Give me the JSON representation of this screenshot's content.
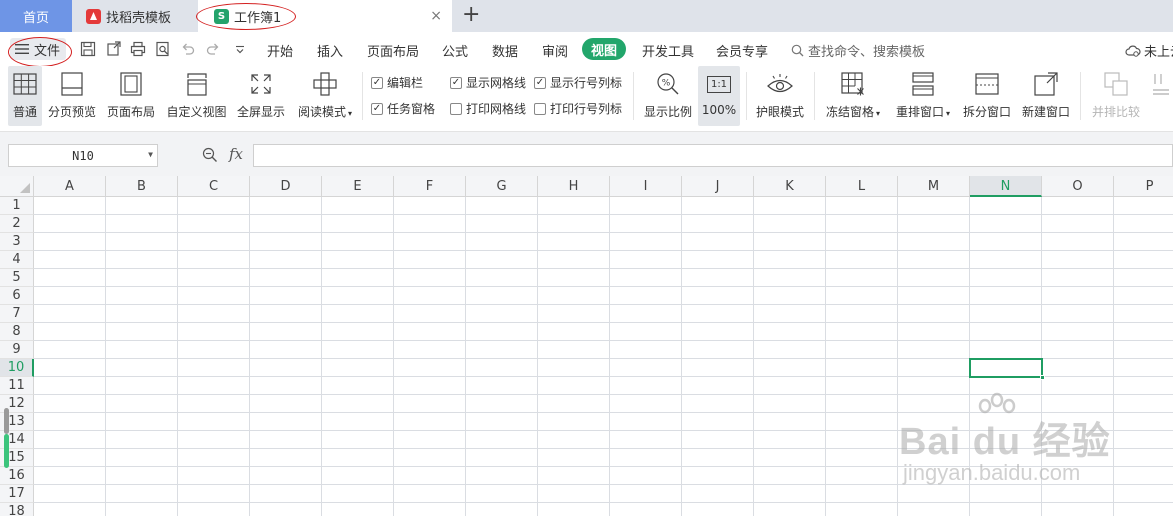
{
  "tabs": {
    "home": "首页",
    "template": "找稻壳模板",
    "workbook": "工作簿1",
    "workbook_logo": "S",
    "add": "+",
    "close": "×"
  },
  "menu": {
    "file": "文件",
    "items": [
      "开始",
      "插入",
      "页面布局",
      "公式",
      "数据",
      "审阅",
      "视图",
      "开发工具",
      "会员专享"
    ],
    "active": "视图",
    "search": "查找命令、搜索模板",
    "cloud": "未上云"
  },
  "ribbon": {
    "normal": "普通",
    "page_break_preview": "分页预览",
    "page_layout": "页面布局",
    "custom_view": "自定义视图",
    "full_screen": "全屏显示",
    "reading_mode": "阅读模式",
    "checks": {
      "edit_bar": {
        "label": "编辑栏",
        "checked": true
      },
      "task_pane": {
        "label": "任务窗格",
        "checked": true
      },
      "show_gridlines": {
        "label": "显示网格线",
        "checked": true
      },
      "print_gridlines": {
        "label": "打印网格线",
        "checked": false
      },
      "show_headings": {
        "label": "显示行号列标",
        "checked": true
      },
      "print_headings": {
        "label": "打印行号列标",
        "checked": false
      }
    },
    "zoom": "显示比例",
    "zoom_100": "100%",
    "zoom_100_icon": "1:1",
    "eye_protection": "护眼模式",
    "freeze_panes": "冻结窗格",
    "arrange": "重排窗口",
    "split": "拆分窗口",
    "new_window": "新建窗口",
    "side_by_side": "并排比较"
  },
  "formula": {
    "namebox": "N10",
    "fx": "fx",
    "value": ""
  },
  "grid": {
    "columns": [
      "A",
      "B",
      "C",
      "D",
      "E",
      "F",
      "G",
      "H",
      "I",
      "J",
      "K",
      "L",
      "M",
      "N",
      "O",
      "P"
    ],
    "rows": [
      "1",
      "2",
      "3",
      "4",
      "5",
      "6",
      "7",
      "8",
      "9",
      "10",
      "11",
      "12",
      "13",
      "14",
      "15",
      "16",
      "17",
      "18"
    ],
    "selected_column": "N",
    "selected_row": "10"
  },
  "watermark": {
    "main": "Bai du 经验",
    "sub": "jingyan.baidu.com"
  },
  "colors": {
    "accent": "#22a66b",
    "home_tab": "#6e95e6",
    "annotation": "#d42020"
  }
}
